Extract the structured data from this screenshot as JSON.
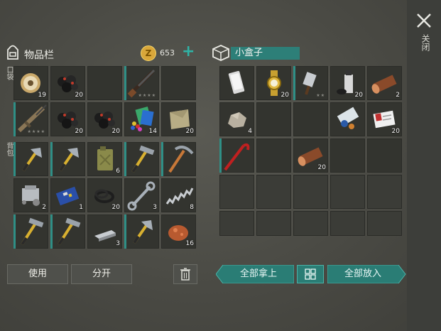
{
  "close": {
    "label": "关闭"
  },
  "inventory": {
    "title": "物品栏",
    "coin_symbol": "Z",
    "coins": "653",
    "add_symbol": "+",
    "pocket_label": "口袋",
    "backpack_label": "背包",
    "slots": [
      {
        "icon": "wire-spool-icon",
        "count": "19"
      },
      {
        "icon": "coal-icon",
        "count": "20"
      },
      {
        "icon": "",
        "count": ""
      },
      {
        "icon": "shotgun-icon",
        "count": "",
        "stars": "★★★★"
      },
      {
        "icon": "",
        "count": ""
      },
      {
        "icon": "assault-rifle-icon",
        "count": "",
        "stars": "★★★★"
      },
      {
        "icon": "coal-icon",
        "count": "20"
      },
      {
        "icon": "coal-icon",
        "count": "20"
      },
      {
        "icon": "colored-pieces-icon",
        "count": "14"
      },
      {
        "icon": "cloth-icon",
        "count": "20"
      },
      {
        "icon": "hatchet-icon",
        "count": ""
      },
      {
        "icon": "hatchet-icon",
        "count": ""
      },
      {
        "icon": "jerrycan-icon",
        "count": "6"
      },
      {
        "icon": "hammer-icon",
        "count": ""
      },
      {
        "icon": "pickaxe-icon",
        "count": ""
      },
      {
        "icon": "engine-part-icon",
        "count": "2"
      },
      {
        "icon": "circuit-board-icon",
        "count": "1"
      },
      {
        "icon": "rubber-ring-icon",
        "count": "20"
      },
      {
        "icon": "wrench-icon",
        "count": "3"
      },
      {
        "icon": "spring-icon",
        "count": "8"
      },
      {
        "icon": "hammer-icon",
        "count": ""
      },
      {
        "icon": "hammer-icon",
        "count": ""
      },
      {
        "icon": "metal-ingot-icon",
        "count": "3"
      },
      {
        "icon": "hatchet-icon",
        "count": ""
      },
      {
        "icon": "copper-ore-icon",
        "count": "16"
      }
    ],
    "use_label": "使用",
    "split_label": "分开",
    "trash_icon": "trash-icon"
  },
  "box": {
    "title": "小盒子",
    "slots": [
      {
        "icon": "smartphone-icon",
        "count": ""
      },
      {
        "icon": "gold-watch-icon",
        "count": "20"
      },
      {
        "icon": "cleaver-icon",
        "count": "",
        "stars": "★★"
      },
      {
        "icon": "spray-can-icon",
        "count": "20"
      },
      {
        "icon": "wood-log-icon",
        "count": "2"
      },
      {
        "icon": "stone-icon",
        "count": "4"
      },
      {
        "icon": "",
        "count": ""
      },
      {
        "icon": "",
        "count": ""
      },
      {
        "icon": "map-scroll-icon",
        "count": ""
      },
      {
        "icon": "id-card-icon",
        "count": "20"
      },
      {
        "icon": "crowbar-icon",
        "count": ""
      },
      {
        "icon": "",
        "count": ""
      },
      {
        "icon": "wood-log-icon",
        "count": "20"
      },
      {
        "icon": "",
        "count": ""
      },
      {
        "icon": "",
        "count": ""
      }
    ],
    "take_all_label": "全部拿上",
    "put_all_label": "全部放入",
    "grid_icon": "grid-icon"
  },
  "colors": {
    "accent": "#2f8f86",
    "coin": "#d9a73a",
    "panel": "#33342f"
  }
}
